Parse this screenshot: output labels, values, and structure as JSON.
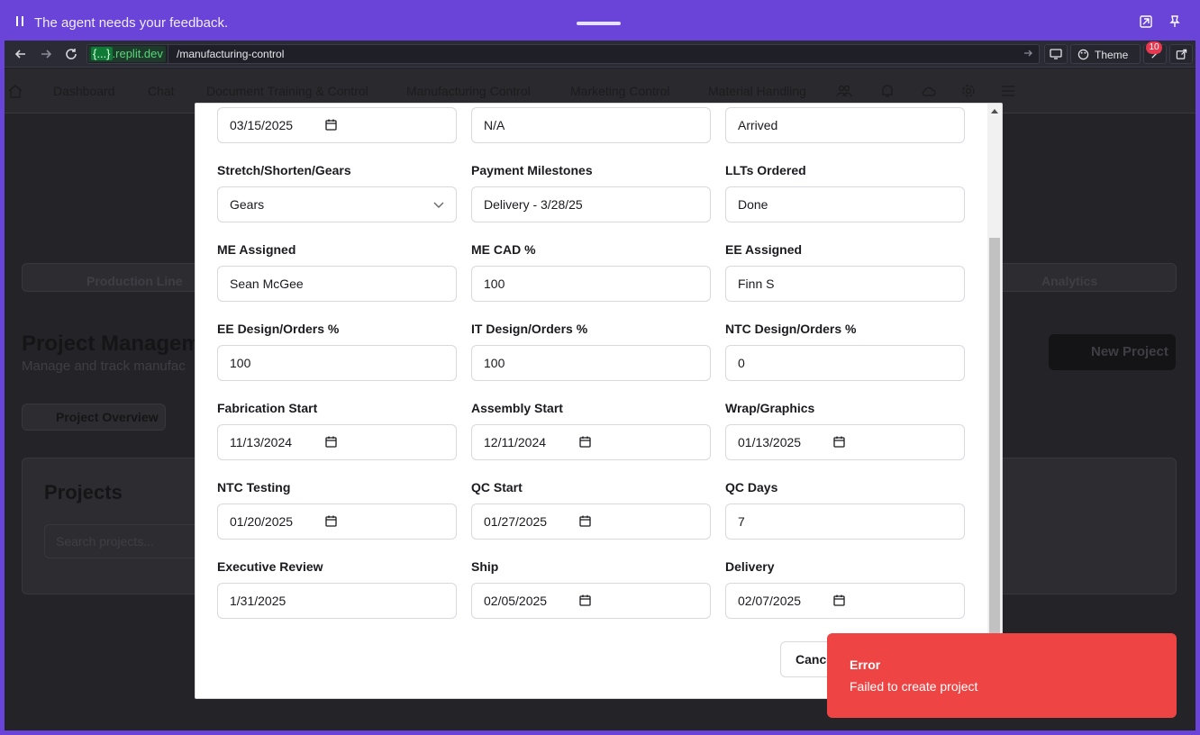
{
  "feedback_bar": {
    "message": "The agent needs your feedback."
  },
  "browser": {
    "url_host_braces": "{...}",
    "url_host_domain": ".replit.dev",
    "url_path": "/manufacturing-control",
    "theme_label": "Theme",
    "notification_count": "10"
  },
  "app_nav": {
    "items": [
      "Dashboard",
      "Chat",
      "Document Training & Control",
      "Manufacturing Control",
      "Marketing Control",
      "Material Handling"
    ]
  },
  "background": {
    "tab_production": "Production Line",
    "tab_analytics": "Analytics",
    "page_title": "Project Managem",
    "page_subtitle": "Manage and track manufac",
    "new_project": "New Project",
    "subtab_overview": "Project Overview",
    "projects_title": "Projects",
    "search_placeholder": "Search projects..."
  },
  "form": {
    "row0": {
      "c1_value": "03/15/2025",
      "c2_value": "N/A",
      "c3_value": "Arrived"
    },
    "row1": {
      "c1_label": "Stretch/Shorten/Gears",
      "c1_value": "Gears",
      "c2_label": "Payment Milestones",
      "c2_value": "Delivery - 3/28/25",
      "c3_label": "LLTs Ordered",
      "c3_value": "Done"
    },
    "row2": {
      "c1_label": "ME Assigned",
      "c1_value": "Sean McGee",
      "c2_label": "ME CAD %",
      "c2_value": "100",
      "c3_label": "EE Assigned",
      "c3_value": "Finn S"
    },
    "row3": {
      "c1_label": "EE Design/Orders %",
      "c1_value": "100",
      "c2_label": "IT Design/Orders %",
      "c2_value": "100",
      "c3_label": "NTC Design/Orders %",
      "c3_value": "0"
    },
    "row4": {
      "c1_label": "Fabrication Start",
      "c1_value": "11/13/2024",
      "c2_label": "Assembly Start",
      "c2_value": "12/11/2024",
      "c3_label": "Wrap/Graphics",
      "c3_value": "01/13/2025"
    },
    "row5": {
      "c1_label": "NTC Testing",
      "c1_value": "01/20/2025",
      "c2_label": "QC Start",
      "c2_value": "01/27/2025",
      "c3_label": "QC Days",
      "c3_value": "7"
    },
    "row6": {
      "c1_label": "Executive Review",
      "c1_value": "1/31/2025",
      "c2_label": "Ship",
      "c2_value": "02/05/2025",
      "c3_label": "Delivery",
      "c3_value": "02/07/2025"
    },
    "cancel_label": "Cancel"
  },
  "toast": {
    "title": "Error",
    "description": "Failed to create project"
  },
  "colors": {
    "accent": "#6a43d8",
    "error": "#ef4444",
    "url_host": "#56d87a"
  }
}
